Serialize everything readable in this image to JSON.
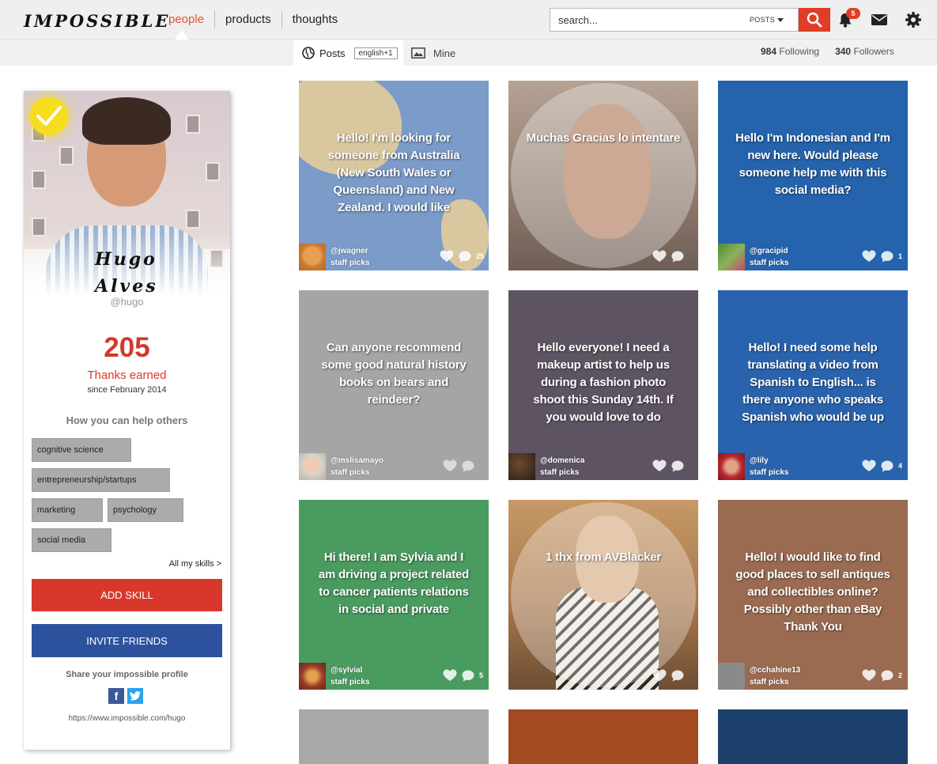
{
  "header": {
    "logo": "IMPOSSIBLE",
    "nav": [
      "people",
      "products",
      "thoughts"
    ],
    "active_nav": "people",
    "search_placeholder": "search...",
    "search_filter": "POSTS",
    "notification_count": "5"
  },
  "subbar": {
    "tab_posts": "Posts",
    "language_badge": "english+1",
    "tab_mine": "Mine",
    "following_count": "984",
    "following_label": "Following",
    "followers_count": "340",
    "followers_label": "Followers"
  },
  "profile": {
    "first_name": "Hugo",
    "last_name": "Alves",
    "handle": "@hugo",
    "thanks_count": "205",
    "thanks_label": "Thanks earned",
    "since": "since February 2014",
    "help_title": "How you can help others",
    "skills": [
      "cognitive science",
      "entrepreneurship/startups",
      "marketing",
      "psychology",
      "social media"
    ],
    "all_skills": "All my skills >",
    "add_skill": "ADD SKILL",
    "invite_friends": "INVITE FRIENDS",
    "share_text": "Share your impossible profile",
    "profile_url": "https://www.impossible.com/hugo"
  },
  "posts": [
    {
      "text": "Hello! I'm looking for someone from Australia (New South Wales or Queensland) and New Zealand. I would like",
      "user": "@jwagner",
      "tag": "staff picks",
      "comments": "25",
      "bg": "#7b9bc8"
    },
    {
      "text": "Muchas Gracias lo intentare",
      "user": "",
      "tag": "",
      "comments": "",
      "bg": "#9a8a7e"
    },
    {
      "text": "Hello I'm Indonesian and I'm new here. Would please someone help me with this social media?",
      "user": "@gracipid",
      "tag": "staff picks",
      "comments": "1",
      "bg": "#2563ad"
    },
    {
      "text": "Can anyone recommend some good natural history books on bears and reindeer?",
      "user": "@mslisamayo",
      "tag": "staff picks",
      "comments": "",
      "bg": "#a5a5a5"
    },
    {
      "text": "Hello everyone! I need a makeup artist to help us during a fashion photo shoot this Sunday 14th. If you would love to do",
      "user": "@domenica",
      "tag": "staff picks",
      "comments": "",
      "bg": "#5e5360"
    },
    {
      "text": "Hello! I need some help translating a video from Spanish to English... is there anyone who speaks Spanish who would be up",
      "user": "@lily",
      "tag": "staff picks",
      "comments": "4",
      "bg": "#2a63ad"
    },
    {
      "text": "Hi there! I am Sylvia and I am driving a project related to cancer patients relations in social and private",
      "user": "@sylvial",
      "tag": "staff picks",
      "comments": "5",
      "bg": "#4a9b5f"
    },
    {
      "text": "1 thx from AVBlacker",
      "user": "",
      "tag": "",
      "comments": "",
      "bg": "#b98a5a"
    },
    {
      "text": "Hello! I would like to find good places to sell antiques and collectibles online? Possibly other than eBay Thank You",
      "user": "@cchahine13",
      "tag": "staff picks",
      "comments": "2",
      "bg": "#9a6b50"
    }
  ],
  "partial_posts": [
    {
      "bg": "#a8a8a8"
    },
    {
      "bg": "#a24a22"
    },
    {
      "bg": "#1c3f6b"
    }
  ],
  "colors": {
    "accent_red": "#d7372a",
    "invite_blue": "#2d529d",
    "nav_active": "#e35336"
  }
}
